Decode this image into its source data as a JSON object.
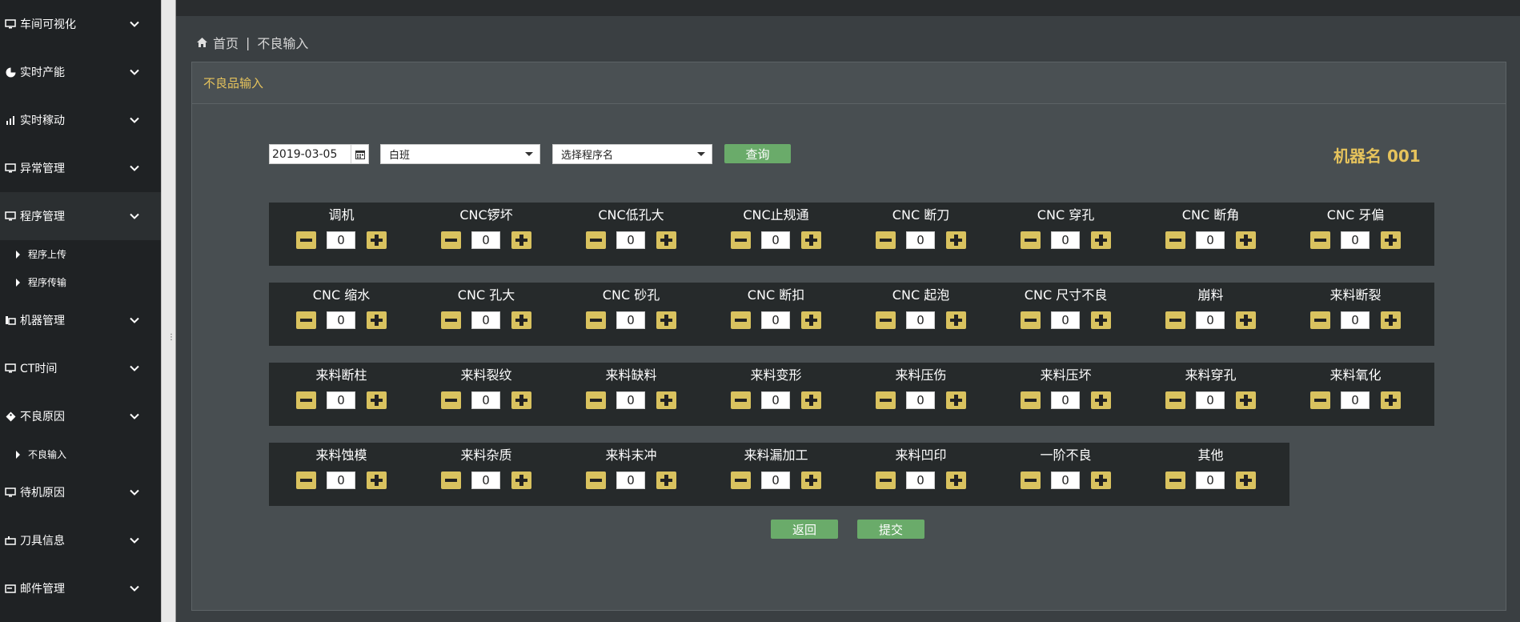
{
  "sidebar": {
    "items": [
      {
        "label": "车间可视化",
        "icon": "monitor-icon"
      },
      {
        "label": "实时产能",
        "icon": "pie-chart-icon"
      },
      {
        "label": "实时稼动",
        "icon": "bar-chart-icon"
      },
      {
        "label": "异常管理",
        "icon": "monitor-icon"
      },
      {
        "label": "程序管理",
        "icon": "monitor-icon",
        "sub": [
          "程序上传",
          "程序传输"
        ]
      },
      {
        "label": "机器管理",
        "icon": "machine-icon"
      },
      {
        "label": "CT时间",
        "icon": "monitor-icon"
      },
      {
        "label": "不良原因",
        "icon": "tag-icon",
        "sub": [
          "不良输入"
        ]
      },
      {
        "label": "待机原因",
        "icon": "monitor-icon"
      },
      {
        "label": "刀具信息",
        "icon": "tool-icon"
      },
      {
        "label": "邮件管理",
        "icon": "mail-icon"
      }
    ]
  },
  "breadcrumb": {
    "home": "首页",
    "sep": "|",
    "current": "不良输入"
  },
  "panel": {
    "title": "不良品输入"
  },
  "filters": {
    "date": "2019-03-05",
    "shift": "白班",
    "program_placeholder": "选择程序名",
    "query_label": "查询"
  },
  "machine_name": "机器名 001",
  "defect_rows": [
    [
      {
        "label": "调机",
        "value": "0"
      },
      {
        "label": "CNC锣坏",
        "value": "0"
      },
      {
        "label": "CNC低孔大",
        "value": "0"
      },
      {
        "label": "CNC止规通",
        "value": "0"
      },
      {
        "label": "CNC 断刀",
        "value": "0"
      },
      {
        "label": "CNC 穿孔",
        "value": "0"
      },
      {
        "label": "CNC 断角",
        "value": "0"
      },
      {
        "label": "CNC 牙偏",
        "value": "0"
      }
    ],
    [
      {
        "label": "CNC 缩水",
        "value": "0"
      },
      {
        "label": "CNC 孔大",
        "value": "0"
      },
      {
        "label": "CNC 砂孔",
        "value": "0"
      },
      {
        "label": "CNC 断扣",
        "value": "0"
      },
      {
        "label": "CNC 起泡",
        "value": "0"
      },
      {
        "label": "CNC 尺寸不良",
        "value": "0"
      },
      {
        "label": "崩料",
        "value": "0"
      },
      {
        "label": "来料断裂",
        "value": "0"
      }
    ],
    [
      {
        "label": "来料断柱",
        "value": "0"
      },
      {
        "label": "来料裂纹",
        "value": "0"
      },
      {
        "label": "来料缺料",
        "value": "0"
      },
      {
        "label": "来料变形",
        "value": "0"
      },
      {
        "label": "来料压伤",
        "value": "0"
      },
      {
        "label": "来料压坏",
        "value": "0"
      },
      {
        "label": "来料穿孔",
        "value": "0"
      },
      {
        "label": "来料氧化",
        "value": "0"
      }
    ],
    [
      {
        "label": "来料蚀模",
        "value": "0"
      },
      {
        "label": "来料杂质",
        "value": "0"
      },
      {
        "label": "来料末冲",
        "value": "0"
      },
      {
        "label": "来料漏加工",
        "value": "0"
      },
      {
        "label": "来料凹印",
        "value": "0"
      },
      {
        "label": "一阶不良",
        "value": "0"
      },
      {
        "label": "其他",
        "value": "0"
      }
    ]
  ],
  "actions": {
    "back_label": "返回",
    "submit_label": "提交"
  },
  "colors": {
    "accent_gold": "#e6c35c",
    "button_green": "#6aab6a",
    "stepper_yellow": "#d9c25f"
  }
}
